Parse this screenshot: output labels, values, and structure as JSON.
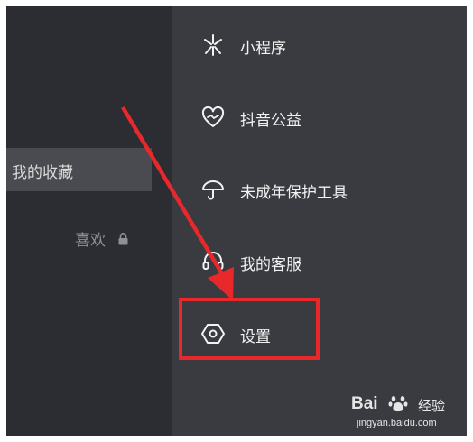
{
  "left_panel": {
    "favorites_tab": "我的收藏",
    "likes_label": "喜欢"
  },
  "menu": {
    "items": [
      {
        "label": "小程序",
        "icon": "mini-program-icon"
      },
      {
        "label": "抖音公益",
        "icon": "charity-heart-icon"
      },
      {
        "label": "未成年保护工具",
        "icon": "umbrella-icon"
      },
      {
        "label": "我的客服",
        "icon": "headset-icon"
      },
      {
        "label": "设置",
        "icon": "settings-hexagon-icon"
      }
    ]
  },
  "annotation": {
    "color": "#e8282b"
  },
  "watermark": {
    "brand_left": "Bai",
    "brand_right": "经验",
    "url": "jingyan.baidu.com"
  },
  "colors": {
    "left_bg": "#2c2d33",
    "right_bg": "#3a3b41",
    "text": "#f2f2f2"
  }
}
